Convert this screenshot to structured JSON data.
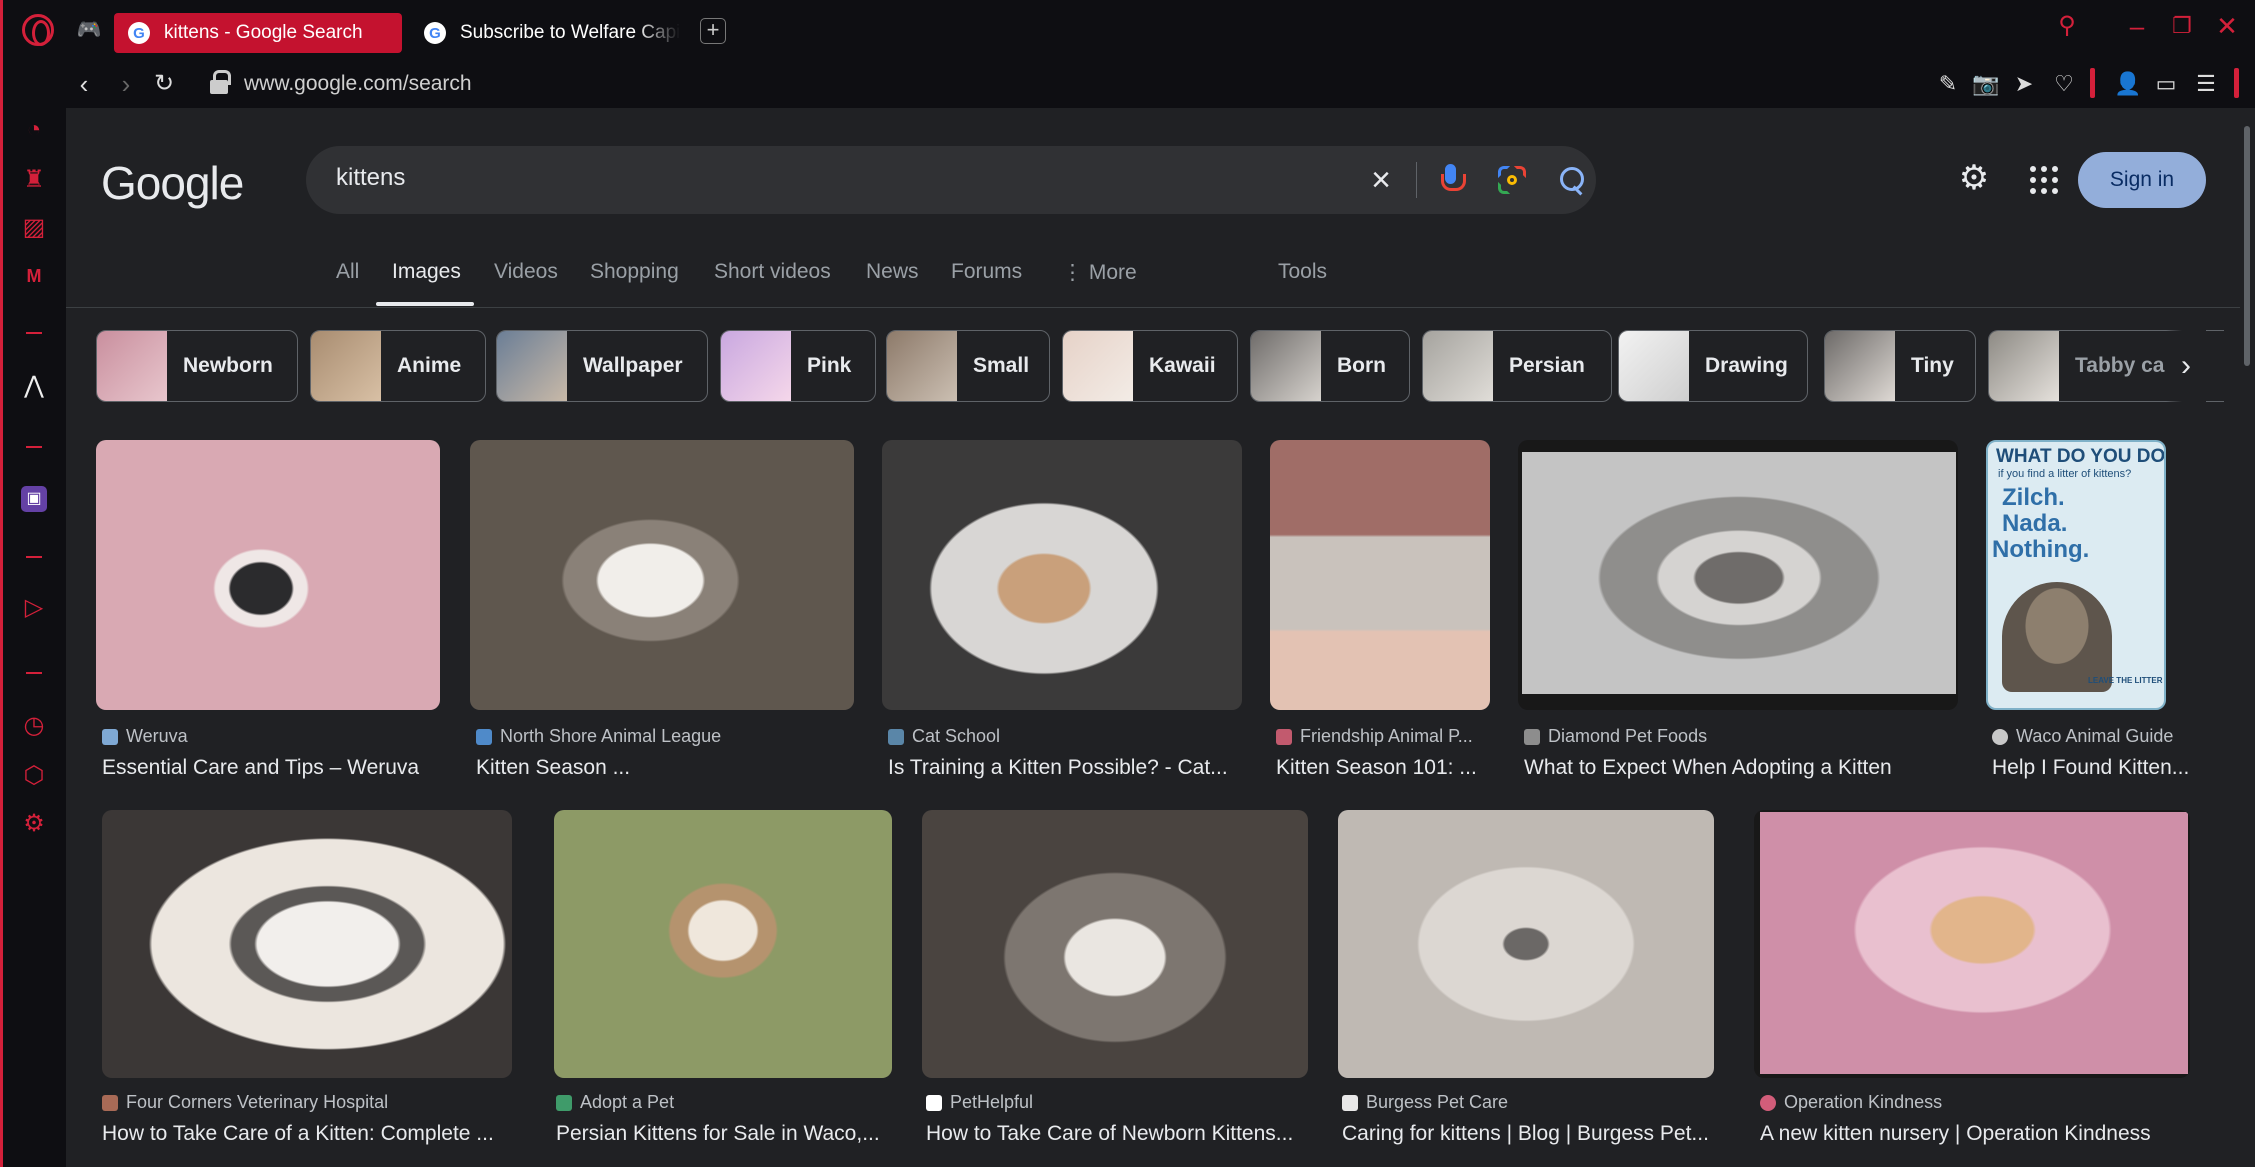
{
  "browser": {
    "tabs": [
      {
        "title": "kittens - Google Search",
        "active": true
      },
      {
        "title": "Subscribe to Welfare Capi",
        "active": false
      }
    ],
    "new_tab": "+",
    "address": "www.google.com/search",
    "accent": "#d4203a"
  },
  "google": {
    "logo": "Google",
    "query": "kittens",
    "sign_in": "Sign in",
    "nav": [
      "All",
      "Images",
      "Videos",
      "Shopping",
      "Short videos",
      "News",
      "Forums",
      "More",
      "Tools"
    ],
    "active_nav": "Images",
    "chips": [
      "Newborn",
      "Anime",
      "Wallpaper",
      "Pink",
      "Small",
      "Kawaii",
      "Born",
      "Persian",
      "Drawing",
      "Tiny",
      "Tabby ca"
    ],
    "results_row1": [
      {
        "source": "Weruva",
        "title": "Essential Care and Tips – Weruva",
        "color": "#d9a9b3"
      },
      {
        "source": "North Shore Animal League",
        "title": "Kitten Season ...",
        "color": "#a99e92"
      },
      {
        "source": "Cat School",
        "title": "Is Training a Kitten Possible? - Cat...",
        "color": "#9c9a98"
      },
      {
        "source": "Friendship Animal P...",
        "title": "Kitten Season 101: ...",
        "color": "#a27f78"
      },
      {
        "source": "Diamond Pet Foods",
        "title": "What to Expect When Adopting a Kitten",
        "color": "#b1b1b1"
      },
      {
        "source": "Waco Animal Guide",
        "title": "Help I Found Kitten...",
        "color": "#c7dde7"
      }
    ],
    "results_row2": [
      {
        "source": "Four Corners Veterinary Hospital",
        "title": "How to Take Care of a Kitten: Complete ...",
        "color": "#b8b0a8"
      },
      {
        "source": "Adopt a Pet",
        "title": "Persian Kittens for Sale in Waco,...",
        "color": "#8d9a66"
      },
      {
        "source": "PetHelpful",
        "title": "How to Take Care of Newborn Kittens...",
        "color": "#8b8782"
      },
      {
        "source": "Burgess Pet Care",
        "title": "Caring for kittens | Blog | Burgess Pet...",
        "color": "#c9c4bf"
      },
      {
        "source": "Operation Kindness",
        "title": "A new kitten nursery | Operation Kindness",
        "color": "#d7a1b4"
      }
    ],
    "waco_text": {
      "line1": "WHAT DO YOU DO",
      "line2": "if you find a litter of kittens?",
      "line3": "Zilch.",
      "line4": "Nada.",
      "line5": "Nothing.",
      "footer": "LEAVE THE LITTER"
    }
  }
}
